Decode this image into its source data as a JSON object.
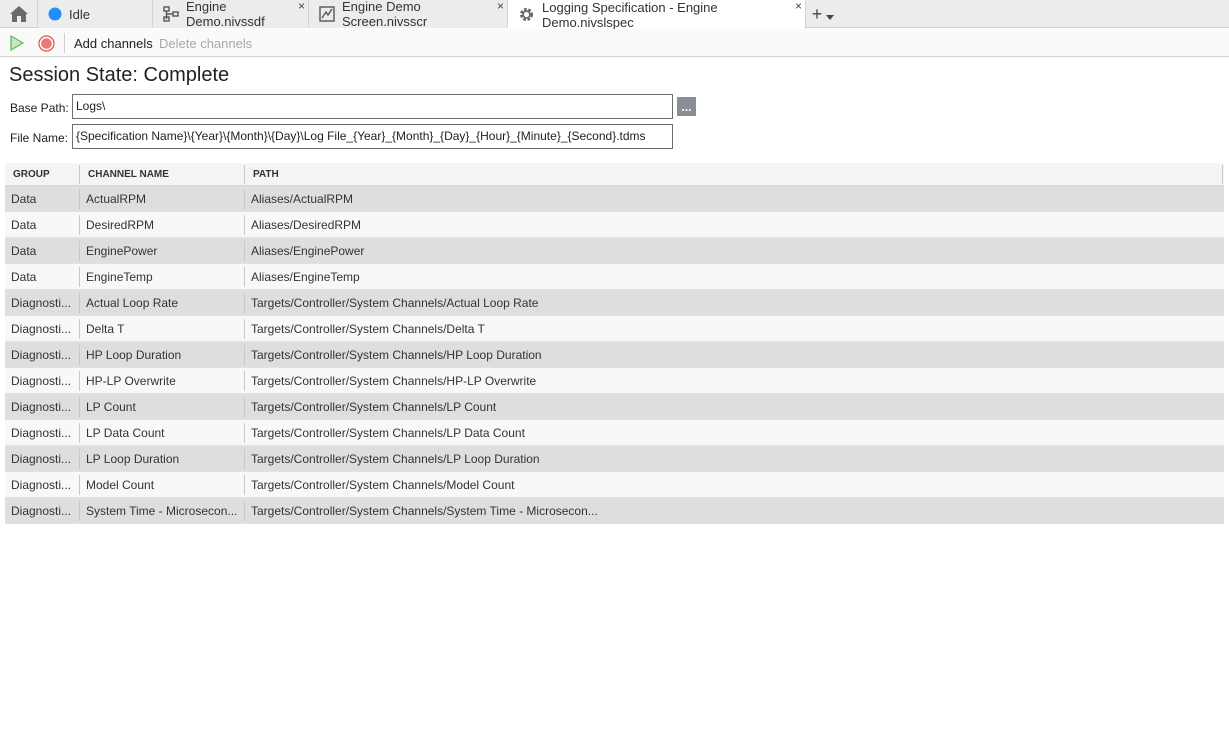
{
  "tabs": [
    {
      "label": "Idle",
      "icon": "status-circle-icon",
      "closable": false
    },
    {
      "label": "Engine Demo.nivssdf",
      "icon": "system-definition-icon",
      "closable": true
    },
    {
      "label": "Engine Demo Screen.nivsscr",
      "icon": "screen-icon",
      "closable": true
    },
    {
      "label": "Logging Specification - Engine Demo.nivslspec",
      "icon": "gear-icon",
      "closable": true
    }
  ],
  "tab_close_glyph": "×",
  "add_tab_glyph": "+",
  "toolbar": {
    "add_channels": "Add channels",
    "delete_channels": "Delete channels"
  },
  "session_state": "Session State: Complete",
  "base_path": {
    "label": "Base Path:",
    "value": "Logs\\",
    "browse": "..."
  },
  "file_name": {
    "label": "File Name:",
    "value": "{Specification Name}\\{Year}\\{Month}\\{Day}\\Log File_{Year}_{Month}_{Day}_{Hour}_{Minute}_{Second}.tdms"
  },
  "table": {
    "columns": [
      "GROUP",
      "CHANNEL NAME",
      "PATH"
    ],
    "rows": [
      {
        "group": "Data",
        "channel": "ActualRPM",
        "path": "Aliases/ActualRPM"
      },
      {
        "group": "Data",
        "channel": "DesiredRPM",
        "path": "Aliases/DesiredRPM"
      },
      {
        "group": "Data",
        "channel": "EnginePower",
        "path": "Aliases/EnginePower"
      },
      {
        "group": "Data",
        "channel": "EngineTemp",
        "path": "Aliases/EngineTemp"
      },
      {
        "group": "Diagnosti...",
        "channel": "Actual Loop Rate",
        "path": "Targets/Controller/System Channels/Actual Loop Rate"
      },
      {
        "group": "Diagnosti...",
        "channel": "Delta T",
        "path": "Targets/Controller/System Channels/Delta T"
      },
      {
        "group": "Diagnosti...",
        "channel": "HP Loop Duration",
        "path": "Targets/Controller/System Channels/HP Loop Duration"
      },
      {
        "group": "Diagnosti...",
        "channel": "HP-LP Overwrite",
        "path": "Targets/Controller/System Channels/HP-LP Overwrite"
      },
      {
        "group": "Diagnosti...",
        "channel": "LP Count",
        "path": "Targets/Controller/System Channels/LP Count"
      },
      {
        "group": "Diagnosti...",
        "channel": "LP Data Count",
        "path": "Targets/Controller/System Channels/LP Data Count"
      },
      {
        "group": "Diagnosti...",
        "channel": "LP Loop Duration",
        "path": "Targets/Controller/System Channels/LP Loop Duration"
      },
      {
        "group": "Diagnosti...",
        "channel": "Model Count",
        "path": "Targets/Controller/System Channels/Model Count"
      },
      {
        "group": "Diagnosti...",
        "channel": "System Time - Microsecon...",
        "path": "Targets/Controller/System Channels/System Time - Microsecon..."
      }
    ]
  },
  "colors": {
    "status_idle": "#1e90ff",
    "run_green": "#5cb85c",
    "stop_red": "#d9534f",
    "row_odd": "#dedede",
    "row_even": "#f8f8f8"
  }
}
